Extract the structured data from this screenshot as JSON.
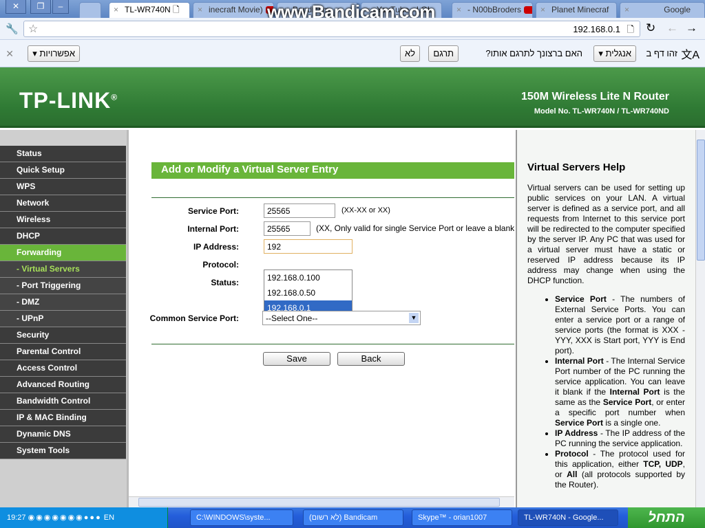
{
  "browser": {
    "tabs": [
      {
        "label": "TL-WR740N",
        "active": true
      },
      {
        "label": "inecraft Movie)"
      },
      {
        "label": "Bandicam"
      },
      {
        "label": "YouTube - LOL"
      },
      {
        "label": "- N00bBroders"
      },
      {
        "label": "Planet Minecraf"
      },
      {
        "label": "Google"
      }
    ],
    "watermark": "www.Bandicam.com",
    "url": "192.168.0.1"
  },
  "translate": {
    "prefix": "זהו דף ב",
    "language": "אנגלית",
    "question": "האם ברצונך לתרגם אותו?",
    "translate_btn": "תרגם",
    "no_btn": "לא",
    "options_btn": "אפשרויות"
  },
  "header": {
    "logo": "TP-LINK",
    "product": "150M Wireless Lite N Router",
    "model": "Model No. TL-WR740N / TL-WR740ND"
  },
  "sidebar": {
    "items": [
      {
        "label": "Status"
      },
      {
        "label": "Quick Setup"
      },
      {
        "label": "WPS"
      },
      {
        "label": "Network"
      },
      {
        "label": "Wireless"
      },
      {
        "label": "DHCP"
      },
      {
        "label": "Forwarding",
        "active": true
      },
      {
        "label": "- Virtual Servers",
        "sub": true,
        "active": true
      },
      {
        "label": "- Port Triggering",
        "sub": true
      },
      {
        "label": "- DMZ",
        "sub": true
      },
      {
        "label": "- UPnP",
        "sub": true
      },
      {
        "label": "Security"
      },
      {
        "label": "Parental Control"
      },
      {
        "label": "Access Control"
      },
      {
        "label": "Advanced Routing"
      },
      {
        "label": "Bandwidth Control"
      },
      {
        "label": "IP & MAC Binding"
      },
      {
        "label": "Dynamic DNS"
      },
      {
        "label": "System Tools"
      }
    ]
  },
  "form": {
    "title": "Add or Modify a Virtual Server Entry",
    "service_port_label": "Service Port:",
    "service_port": "25565",
    "service_port_hint": "(XX-XX or XX)",
    "internal_port_label": "Internal Port:",
    "internal_port": "25565",
    "internal_port_hint": "(XX, Only valid for single Service Port or leave a blank",
    "ip_label": "IP Address:",
    "ip": "192",
    "ip_suggestions": [
      "192.168.0.100",
      "192.168.0.50",
      "192.168.0.1"
    ],
    "protocol_label": "Protocol:",
    "status_label": "Status:",
    "common_label": "Common Service Port:",
    "common_value": "--Select One--",
    "save": "Save",
    "back": "Back"
  },
  "help": {
    "title": "Virtual Servers Help",
    "intro": "Virtual servers can be used for setting up public services on your LAN. A virtual server is defined as a service port, and all requests from Internet to this service port will be redirected to the computer specified by the server IP. Any PC that was used for a virtual server must have a static or reserved IP address because its IP address may change when using the DHCP function.",
    "items": [
      [
        {
          "b": "Service Port"
        },
        {
          "t": " - The numbers of External Service Ports. You can enter a service port or a range of service ports (the format is XXX - YYY, XXX is Start port, YYY is End port)."
        }
      ],
      [
        {
          "b": "Internal Port"
        },
        {
          "t": " - The Internal Service Port number of the PC running the service application. You can leave it blank if the "
        },
        {
          "b": "Internal Port"
        },
        {
          "t": " is the same as the "
        },
        {
          "b": "Service Port"
        },
        {
          "t": ", or enter a specific port number when "
        },
        {
          "b": "Service Port"
        },
        {
          "t": " is a single one."
        }
      ],
      [
        {
          "b": "IP Address"
        },
        {
          "t": " - The IP address of the PC running the service application."
        }
      ],
      [
        {
          "b": "Protocol"
        },
        {
          "t": " - The protocol used for this application, either "
        },
        {
          "b": "TCP, UDP"
        },
        {
          "t": ", or "
        },
        {
          "b": "All"
        },
        {
          "t": " (all protocols supported by the Router)."
        }
      ]
    ]
  },
  "taskbar": {
    "clock": "19:27",
    "lang": "EN",
    "tasks": [
      "C:\\WINDOWS\\syste...",
      "(לא רשום) Bandicam",
      "Skype™ - orian1007",
      "TL-WR740N - Google..."
    ],
    "start": "התחל"
  }
}
